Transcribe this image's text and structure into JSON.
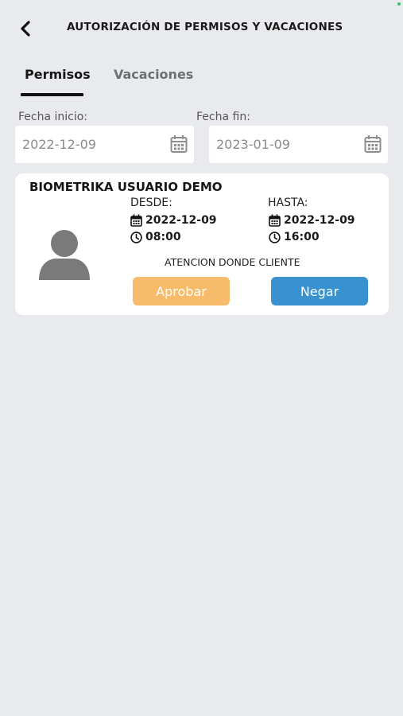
{
  "header": {
    "title": "AUTORIZACIÓN DE PERMISOS Y VACACIONES",
    "back_icon": "chevron-left-icon"
  },
  "tabs": [
    {
      "label": "Permisos",
      "active": true
    },
    {
      "label": "Vacaciones",
      "active": false
    }
  ],
  "filters": {
    "start": {
      "label": "Fecha inicio:",
      "value": "2022-12-09",
      "icon": "calendar-icon"
    },
    "end": {
      "label": "Fecha fin:",
      "value": "2023-01-09",
      "icon": "calendar-icon"
    }
  },
  "requests": [
    {
      "name": "BIOMETRIKA USUARIO DEMO",
      "avatar_icon": "user-avatar-icon",
      "desde": {
        "label": "DESDE:",
        "date": "2022-12-09",
        "time": "08:00"
      },
      "hasta": {
        "label": "HASTA:",
        "date": "2022-12-09",
        "time": "16:00"
      },
      "reason": "ATENCION DONDE CLIENTE",
      "approve_label": "Aprobar",
      "deny_label": "Negar"
    }
  ],
  "colors": {
    "background": "#e9eaed",
    "approve": "#f6bb6b",
    "deny": "#3a91cf",
    "active_tab": "#161616",
    "inactive_tab": "#6e6f72"
  }
}
